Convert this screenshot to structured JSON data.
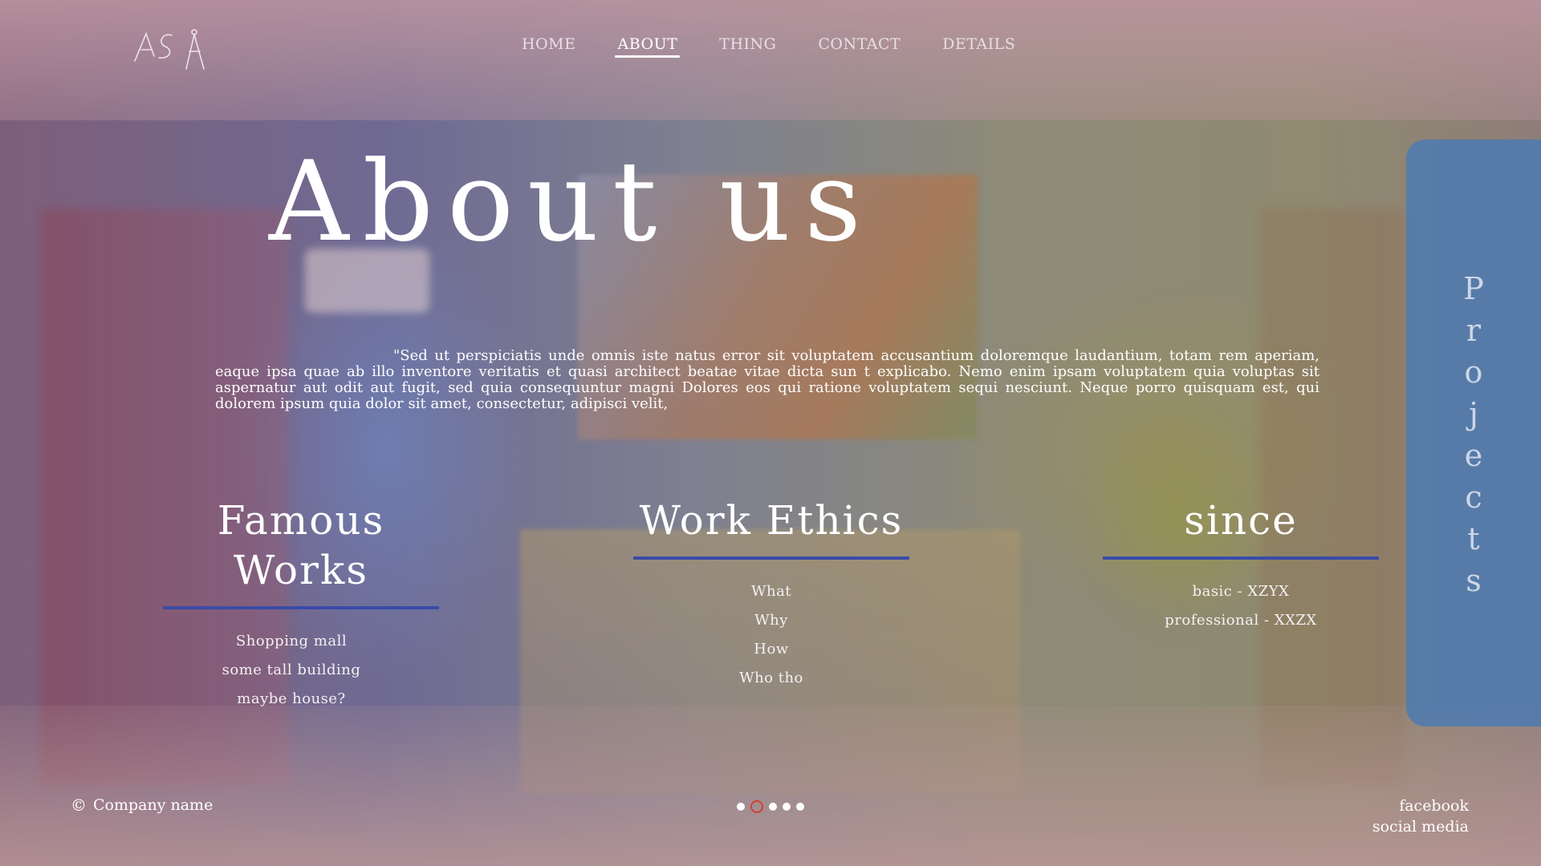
{
  "brand": {
    "logo_text": "AS",
    "logo_icon": "compass-icon"
  },
  "nav": {
    "items": [
      {
        "label": "HOME",
        "active": false
      },
      {
        "label": "ABOUT",
        "active": true
      },
      {
        "label": "THING",
        "active": false
      },
      {
        "label": "CONTACT",
        "active": false
      },
      {
        "label": "DETAILS",
        "active": false
      }
    ]
  },
  "hero": {
    "title": "About us",
    "text": "\"Sed ut perspiciatis unde omnis iste natus error sit voluptatem accusantium doloremque laudantium, totam rem aperiam, eaque ipsa quae ab illo inventore veritatis et quasi architect beatae vitae dicta sun t explicabo. Nemo enim ipsam voluptatem quia voluptas sit aspernatur aut odit aut fugit, sed quia consequuntur magni Dolores eos qui ratione voluptatem sequi nesciunt. Neque porro quisquam est, qui dolorem ipsum quia dolor sit amet, consectetur, adipisci velit,"
  },
  "columns": [
    {
      "title": "Famous Works",
      "items": [
        "Shopping mall",
        "some tall building",
        "maybe house?"
      ]
    },
    {
      "title": "Work Ethics",
      "items": [
        "What",
        "Why",
        "How",
        "Who tho"
      ]
    },
    {
      "title": "since",
      "items": [
        "basic - XZYX",
        "professional - XXZX"
      ]
    }
  ],
  "projects_tab": {
    "letters": [
      "P",
      "r",
      "o",
      "j",
      "e",
      "c",
      "t",
      "s"
    ]
  },
  "footer": {
    "copyright_symbol": "©",
    "company": "Company name",
    "links": [
      "facebook",
      "social media"
    ]
  },
  "pager": {
    "count": 5,
    "active_index": 1
  },
  "colors": {
    "accent_rule": "#3a4ba8",
    "projects_tab": "#4e7ab2",
    "active_dot": "#d1402e"
  }
}
